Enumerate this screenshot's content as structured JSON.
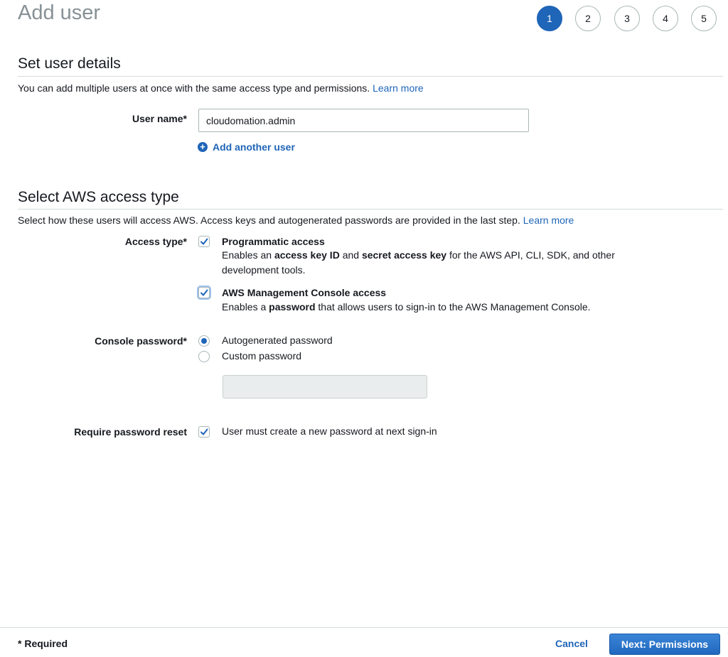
{
  "header": {
    "title": "Add user",
    "steps": [
      {
        "label": "1",
        "active": true
      },
      {
        "label": "2",
        "active": false
      },
      {
        "label": "3",
        "active": false
      },
      {
        "label": "4",
        "active": false
      },
      {
        "label": "5",
        "active": false
      }
    ]
  },
  "user_details": {
    "title": "Set user details",
    "description": "You can add multiple users at once with the same access type and permissions.",
    "learn_more": "Learn more",
    "user_name_label": "User name*",
    "user_name_value": "cloudomation.admin",
    "add_another_user": "Add another user"
  },
  "access_type": {
    "title": "Select AWS access type",
    "description": "Select how these users will access AWS. Access keys and autogenerated passwords are provided in the last step.",
    "learn_more": "Learn more",
    "label": "Access type*",
    "programmatic": {
      "title": "Programmatic access",
      "checked": true,
      "desc_1": "Enables an ",
      "bold_1": "access key ID",
      "desc_2": " and ",
      "bold_2": "secret access key",
      "desc_3": " for the AWS API, CLI, SDK, and other development tools."
    },
    "console": {
      "title": "AWS Management Console access",
      "checked": true,
      "desc_1": "Enables a ",
      "bold_1": "password",
      "desc_2": " that allows users to sign-in to the AWS Management Console."
    }
  },
  "console_password": {
    "label": "Console password*",
    "options": [
      {
        "label": "Autogenerated password",
        "selected": true
      },
      {
        "label": "Custom password",
        "selected": false
      }
    ],
    "custom_value": ""
  },
  "password_reset": {
    "label": "Require password reset",
    "checked": true,
    "text": "User must create a new password at next sign-in"
  },
  "footer": {
    "required_note": "* Required",
    "cancel": "Cancel",
    "next": "Next: Permissions"
  },
  "colors": {
    "accent": "#1f65b8",
    "title_gray": "#879196",
    "border": "#aab7b8"
  }
}
